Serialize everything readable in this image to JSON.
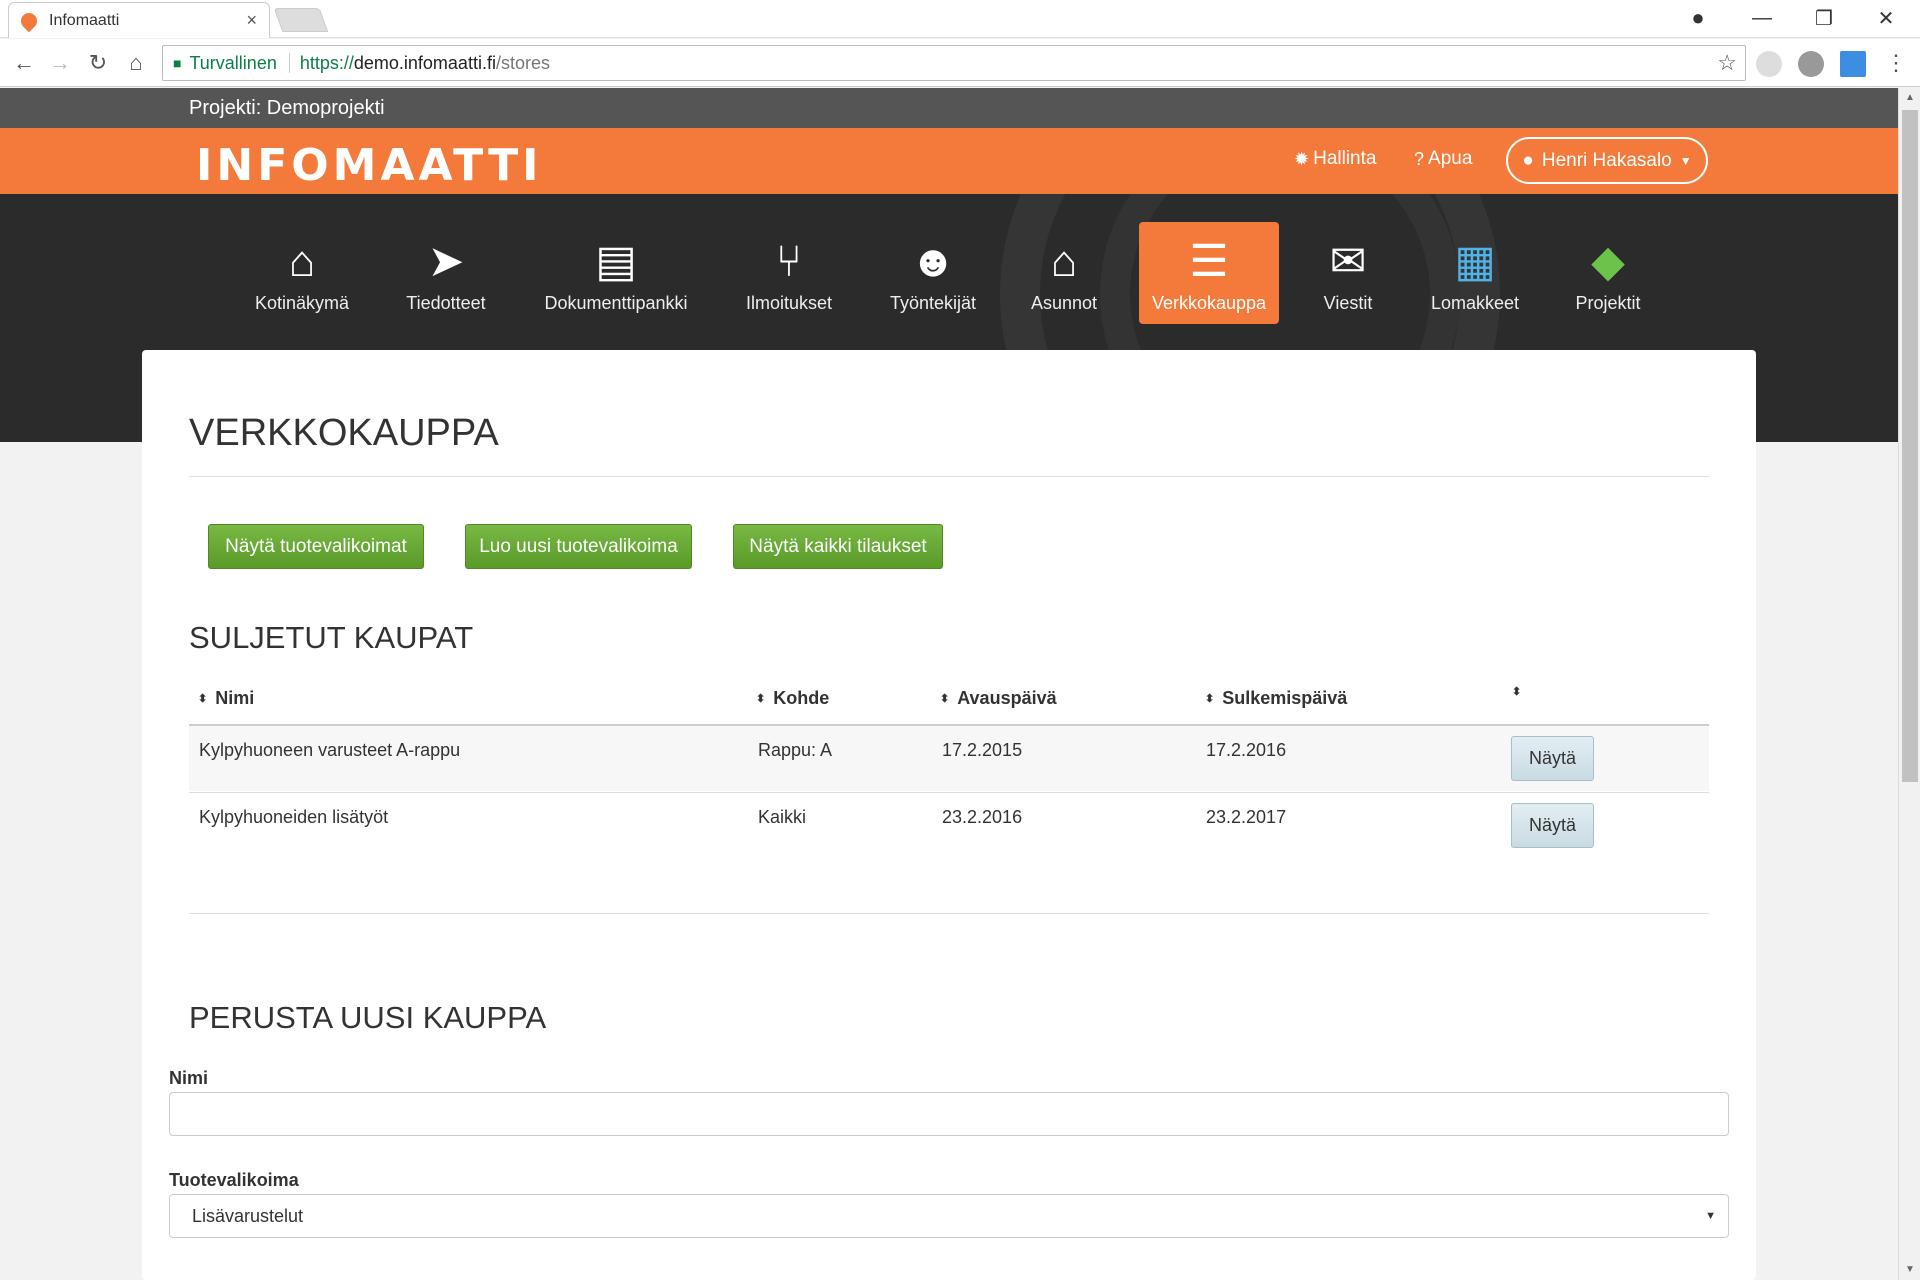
{
  "browser": {
    "tab_title": "Infomaatti",
    "tab_close": "×",
    "secure_label": "Turvallinen",
    "url_scheme": "https://",
    "url_host": "demo.infomaatti.fi",
    "url_path": "/stores",
    "win_minimize": "—",
    "win_restore": "❐",
    "win_close": "✕"
  },
  "project_bar": {
    "label": "Projekti: Demoprojekti"
  },
  "header": {
    "logo": "INFOMAATTI",
    "admin_label": "Hallinta",
    "help_label": "Apua",
    "user_name": "Henri Hakasalo"
  },
  "nav": {
    "items": [
      {
        "label": "Kotinäkymä",
        "icon": "home-icon"
      },
      {
        "label": "Tiedotteet",
        "icon": "paper-plane-icon"
      },
      {
        "label": "Dokumenttipankki",
        "icon": "clipboard-icon"
      },
      {
        "label": "Ilmoitukset",
        "icon": "git-branch-icon"
      },
      {
        "label": "Työntekijät",
        "icon": "users-icon"
      },
      {
        "label": "Asunnot",
        "icon": "home-icon"
      },
      {
        "label": "Verkkokauppa",
        "icon": "database-icon"
      },
      {
        "label": "Viestit",
        "icon": "envelope-icon"
      },
      {
        "label": "Lomakkeet",
        "icon": "form-icon"
      },
      {
        "label": "Projektit",
        "icon": "cubes-icon"
      }
    ],
    "active_index": 6
  },
  "page": {
    "title": "VERKKOKAUPPA",
    "buttons": {
      "show_selections": "Näytä tuotevalikoimat",
      "create_selection": "Luo uusi tuotevalikoima",
      "show_orders": "Näytä kaikki tilaukset"
    },
    "closed_stores": {
      "title": "SULJETUT KAUPAT",
      "columns": [
        "Nimi",
        "Kohde",
        "Avauspäivä",
        "Sulkemispäivä",
        ""
      ],
      "rows": [
        {
          "name": "Kylpyhuoneen varusteet A-rappu",
          "target": "Rappu: A",
          "opened": "17.2.2015",
          "closed": "17.2.2016",
          "action": "Näytä"
        },
        {
          "name": "Kylpyhuoneiden lisätyöt",
          "target": "Kaikki",
          "opened": "23.2.2016",
          "closed": "23.2.2017",
          "action": "Näytä"
        }
      ]
    },
    "new_store": {
      "title": "PERUSTA UUSI KAUPPA",
      "name_label": "Nimi",
      "name_value": "",
      "selection_label": "Tuotevalikoima",
      "selection_value": "Lisävarustelut"
    }
  },
  "colors": {
    "brand_orange": "#f47a3c",
    "dark_nav": "#2b2b2b",
    "project_bar": "#555555",
    "green_button": "#6aaa35"
  }
}
